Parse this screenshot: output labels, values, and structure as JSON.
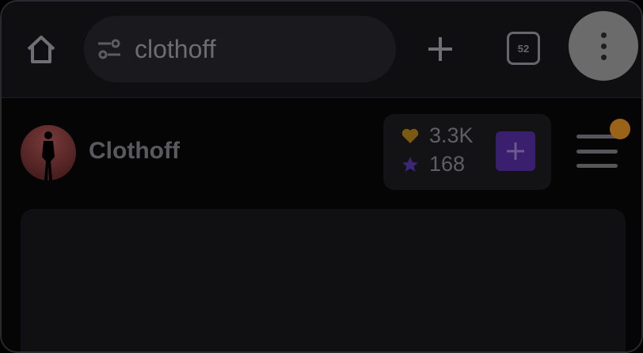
{
  "browser": {
    "url_text": "clothoff",
    "tab_count": "52",
    "icons": [
      "home-icon",
      "tune-icon",
      "plus-icon",
      "tabs-icon",
      "more-vert-icon"
    ]
  },
  "site": {
    "brand_name": "Clothoff",
    "balance": {
      "coins": "3.3K",
      "stars": "168",
      "coin_icon": "heart-coin-icon",
      "star_icon": "star-icon"
    },
    "colors": {
      "accent": "#3a1f6e",
      "notification": "#9a6318",
      "coin": "#7a5a12",
      "star": "#3c2678"
    }
  }
}
